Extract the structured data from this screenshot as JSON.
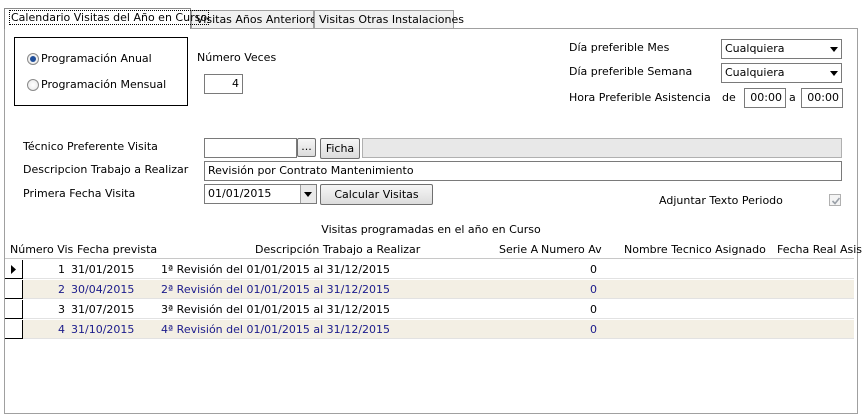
{
  "tabs": [
    {
      "label": "Calendario Visitas del Año en Curso",
      "active": true
    },
    {
      "label": "Visitas Años Anteriores",
      "active": false
    },
    {
      "label": "Visitas Otras Instalaciones",
      "active": false
    }
  ],
  "programacion": {
    "anual_label": "Programación Anual",
    "anual_selected": true,
    "mensual_label": "Programación Mensual",
    "mensual_selected": false
  },
  "numero_veces": {
    "label": "Número Veces",
    "value": "4"
  },
  "preferencias": {
    "dia_mes_label": "Día preferible Mes",
    "dia_mes_value": "Cualquiera",
    "dia_semana_label": "Día preferible Semana",
    "dia_semana_value": "Cualquiera",
    "hora_label": "Hora Preferible Asistencia",
    "de_label": "de",
    "hora_desde": "00:00",
    "a_label": "a",
    "hora_hasta": "00:00"
  },
  "tecnico": {
    "label": "Técnico Preferente Visita",
    "value": "",
    "browse_label": "...",
    "ficha_label": "Ficha",
    "nombre": ""
  },
  "descripcion": {
    "label": "Descripcion Trabajo a Realizar",
    "value": "Revisión por Contrato Mantenimiento"
  },
  "primera_fecha": {
    "label": "Primera Fecha Visita",
    "value": "01/01/2015",
    "calcular_label": "Calcular Visitas"
  },
  "adjuntar": {
    "label": "Adjuntar Texto Periodo",
    "checked": true
  },
  "grid": {
    "title": "Visitas programadas en el año en Curso",
    "columns": [
      "Número Vis",
      "Fecha prevista",
      "Descripción Trabajo a Realizar",
      "Serie A",
      "Numero Av",
      "Nombre Tecnico Asignado",
      "Fecha Real Asis"
    ],
    "rows": [
      {
        "num": "1",
        "fecha": "31/01/2015",
        "descripcion": "1ª Revisión del 01/01/2015 al 31/12/2015",
        "serie": "",
        "numero_av": "0",
        "tecnico": "",
        "fecha_real": ""
      },
      {
        "num": "2",
        "fecha": "30/04/2015",
        "descripcion": "2ª Revisión del 01/01/2015 al 31/12/2015",
        "serie": "",
        "numero_av": "0",
        "tecnico": "",
        "fecha_real": ""
      },
      {
        "num": "3",
        "fecha": "31/07/2015",
        "descripcion": "3ª Revisión del 01/01/2015 al 31/12/2015",
        "serie": "",
        "numero_av": "0",
        "tecnico": "",
        "fecha_real": ""
      },
      {
        "num": "4",
        "fecha": "31/10/2015",
        "descripcion": "4ª Revisión del 01/01/2015 al 31/12/2015",
        "serie": "",
        "numero_av": "0",
        "tecnico": "",
        "fecha_real": ""
      }
    ]
  }
}
